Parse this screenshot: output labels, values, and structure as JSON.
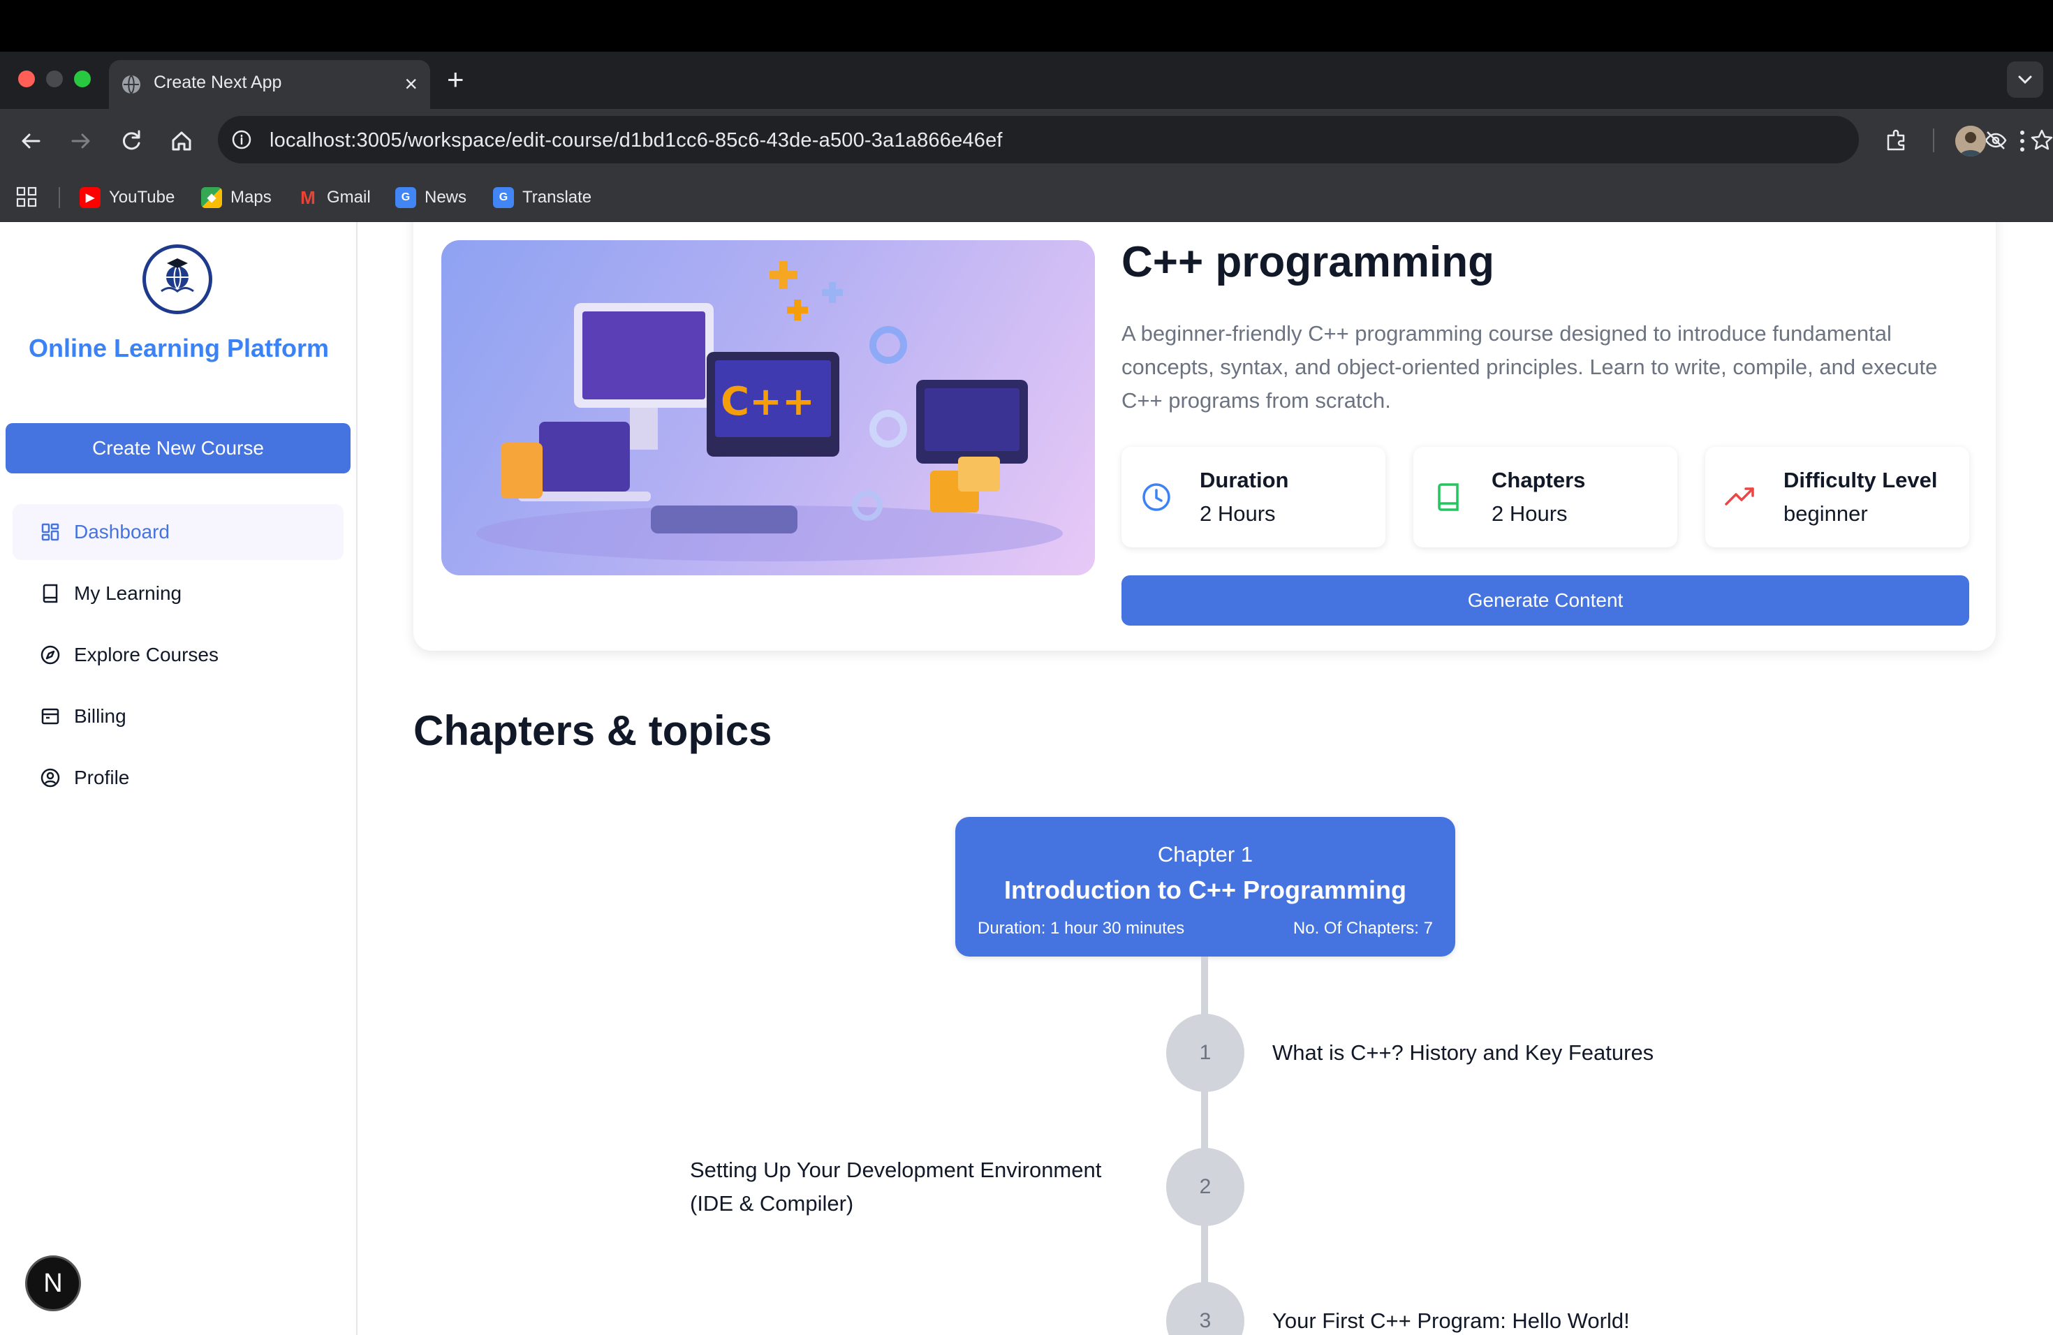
{
  "browser": {
    "tab_title": "Create Next App",
    "tab_close": "×",
    "new_tab": "+",
    "url": "localhost:3005/workspace/edit-course/d1bd1cc6-85c6-43de-a500-3a1a866e46ef",
    "bookmarks": [
      {
        "label": "YouTube",
        "icon": "youtube-icon",
        "color": "#ff0000"
      },
      {
        "label": "Maps",
        "icon": "maps-icon",
        "color": "#34a853"
      },
      {
        "label": "Gmail",
        "icon": "gmail-icon",
        "color": "#ea4335"
      },
      {
        "label": "News",
        "icon": "news-icon",
        "color": "#4285f4"
      },
      {
        "label": "Translate",
        "icon": "translate-icon",
        "color": "#4285f4"
      }
    ]
  },
  "sidebar": {
    "brand": "Online Learning Platform",
    "create_button": "Create New Course",
    "items": [
      {
        "label": "Dashboard",
        "icon": "dashboard-icon",
        "active": true
      },
      {
        "label": "My Learning",
        "icon": "book-icon",
        "active": false
      },
      {
        "label": "Explore Courses",
        "icon": "compass-icon",
        "active": false
      },
      {
        "label": "Billing",
        "icon": "billing-icon",
        "active": false
      },
      {
        "label": "Profile",
        "icon": "profile-icon",
        "active": false
      }
    ],
    "badge": "N"
  },
  "course": {
    "title": "C++ programming",
    "description": "A beginner-friendly C++ programming course designed to introduce fundamental concepts, syntax, and object-oriented principles. Learn to write, compile, and execute C++ programs from scratch.",
    "stats": [
      {
        "label": "Duration",
        "value": "2 Hours",
        "icon": "clock-icon",
        "color": "#3b82f6"
      },
      {
        "label": "Chapters",
        "value": "2 Hours",
        "icon": "book-icon",
        "color": "#22c55e"
      },
      {
        "label": "Difficulty Level",
        "value": "beginner",
        "icon": "trending-up-icon",
        "color": "#ef4444"
      }
    ],
    "generate_button": "Generate Content",
    "banner_text": "C++"
  },
  "chapters": {
    "heading": "Chapters & topics",
    "chapter": {
      "number": "Chapter 1",
      "title": "Introduction to C++ Programming",
      "duration": "Duration: 1 hour 30 minutes",
      "count": "No. Of Chapters: 7"
    },
    "topics": [
      {
        "num": "1",
        "text": "What is C++? History and Key Features"
      },
      {
        "num": "2",
        "text": "Setting Up Your Development Environment (IDE & Compiler)"
      },
      {
        "num": "3",
        "text": "Your First C++ Program: Hello World!"
      }
    ]
  },
  "colors": {
    "accent": "#4574e0",
    "brand": "#3b82f6",
    "chrome_dark": "#35363a"
  }
}
